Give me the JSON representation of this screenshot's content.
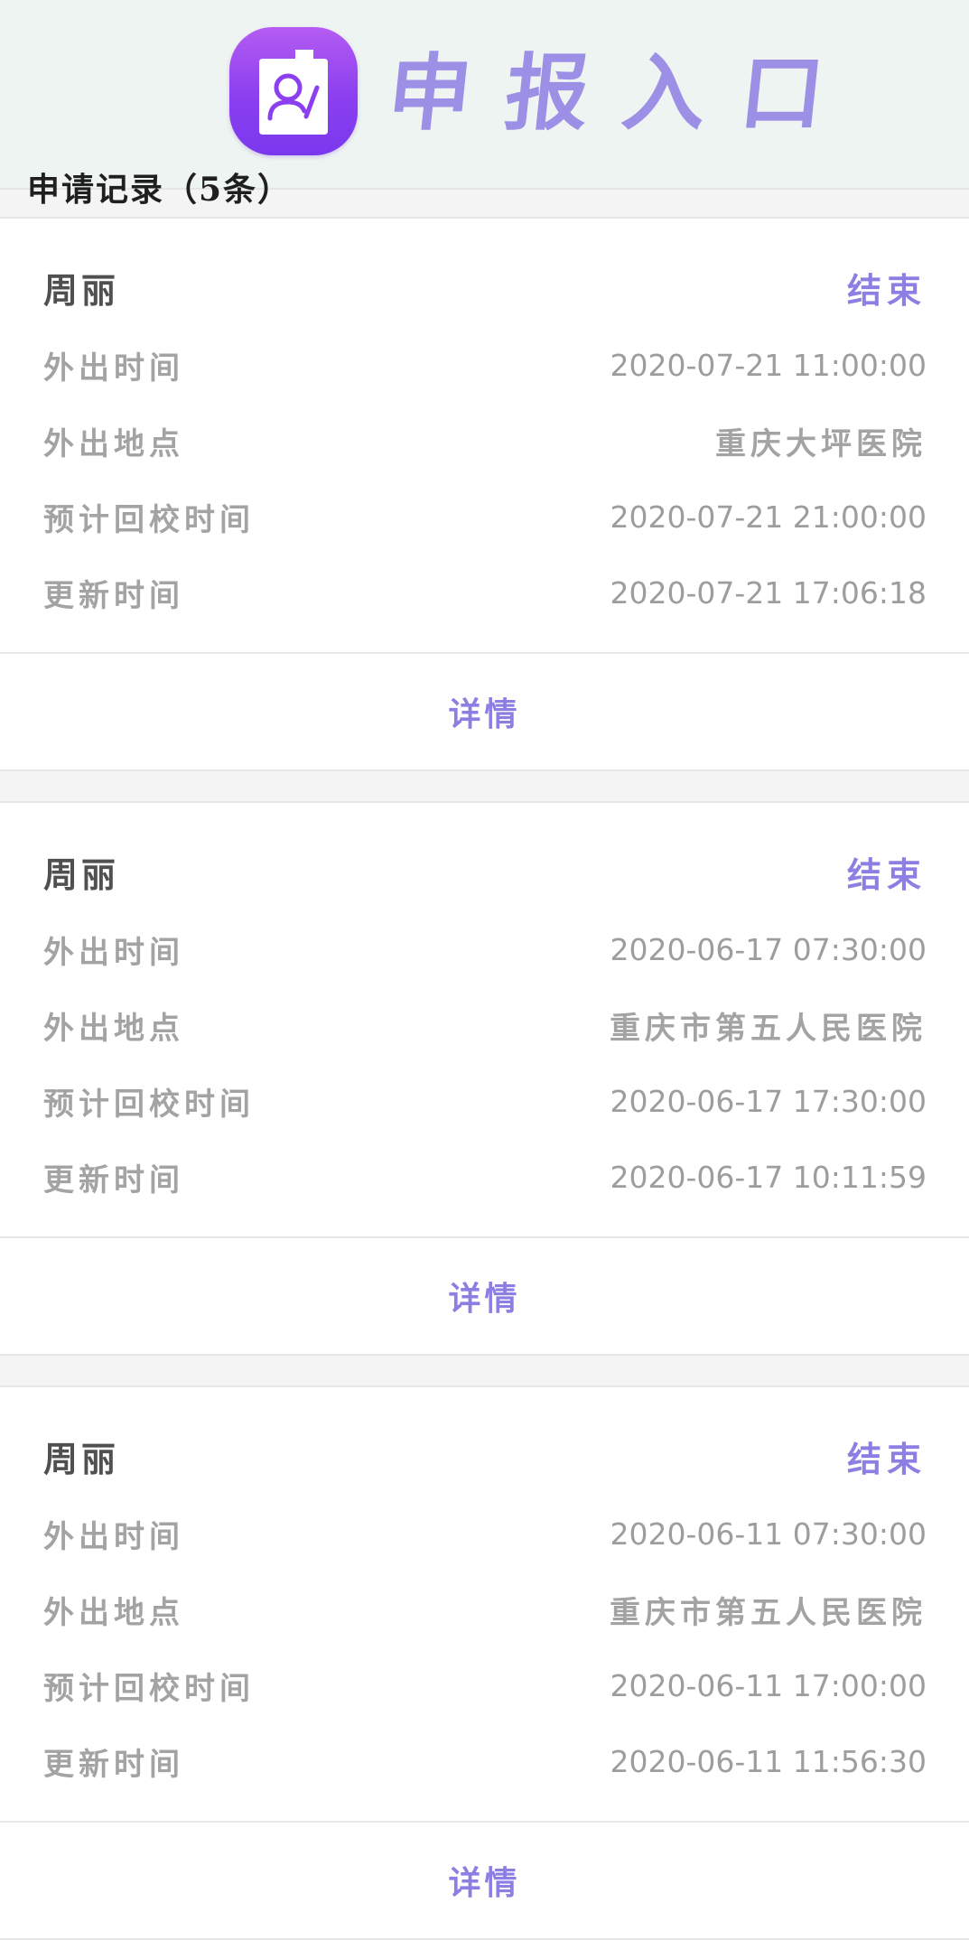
{
  "header": {
    "title": "申报入口",
    "icon": "profile-document-icon",
    "icon_color": "#8b3ff0",
    "title_color": "#9b8fe6"
  },
  "records_title": "申请记录（5条）",
  "accent_color": "#8c7fe3",
  "records": [
    {
      "name": "周丽",
      "status": "结束",
      "fields": [
        {
          "label": "外出时间",
          "value": "2020-07-21 11:00:00"
        },
        {
          "label": "外出地点",
          "value": "重庆大坪医院"
        },
        {
          "label": "预计回校时间",
          "value": "2020-07-21 21:00:00"
        },
        {
          "label": "更新时间",
          "value": "2020-07-21 17:06:18"
        }
      ],
      "detail_label": "详情"
    },
    {
      "name": "周丽",
      "status": "结束",
      "fields": [
        {
          "label": "外出时间",
          "value": "2020-06-17 07:30:00"
        },
        {
          "label": "外出地点",
          "value": "重庆市第五人民医院"
        },
        {
          "label": "预计回校时间",
          "value": "2020-06-17 17:30:00"
        },
        {
          "label": "更新时间",
          "value": "2020-06-17 10:11:59"
        }
      ],
      "detail_label": "详情"
    },
    {
      "name": "周丽",
      "status": "结束",
      "fields": [
        {
          "label": "外出时间",
          "value": "2020-06-11 07:30:00"
        },
        {
          "label": "外出地点",
          "value": "重庆市第五人民医院"
        },
        {
          "label": "预计回校时间",
          "value": "2020-06-11 17:00:00"
        },
        {
          "label": "更新时间",
          "value": "2020-06-11 11:56:30"
        }
      ],
      "detail_label": "详情"
    }
  ]
}
